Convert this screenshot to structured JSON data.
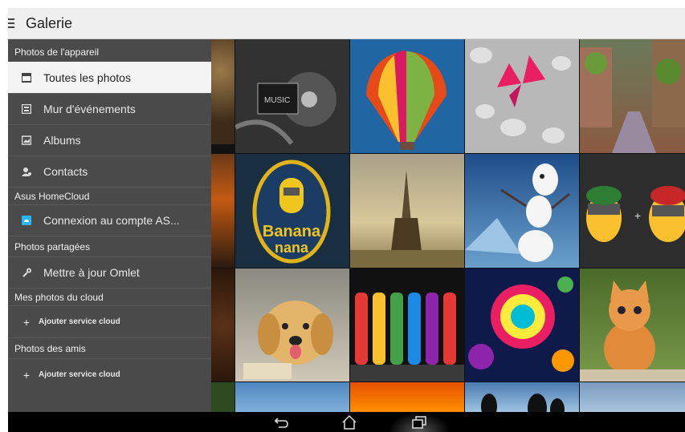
{
  "app": {
    "title": "Galerie"
  },
  "drawer": {
    "device_section": "Photos de l'appareil",
    "device_items": [
      {
        "label": "Toutes les photos",
        "icon": "photos-icon",
        "selected": true
      },
      {
        "label": "Mur d'événements",
        "icon": "event-wall-icon"
      },
      {
        "label": "Albums",
        "icon": "album-icon"
      },
      {
        "label": "Contacts",
        "icon": "contacts-icon"
      }
    ],
    "homecloud_section": "Asus HomeCloud",
    "homecloud_item": {
      "label": "Connexion au compte AS...",
      "icon": "cloud-icon"
    },
    "shared_section": "Photos partagées",
    "shared_item": {
      "label": "Mettre à jour Omlet",
      "icon": "wrench-icon"
    },
    "cloud_section": "Mes photos du cloud",
    "cloud_item": {
      "label": "Ajouter service cloud",
      "icon": "plus-icon"
    },
    "friends_section": "Photos des amis",
    "friends_item": {
      "label": "Ajouter service cloud",
      "icon": "plus-icon"
    }
  },
  "grid": {
    "photos": [
      "music-cd-art",
      "hot-air-balloon",
      "pink-butterfly-pebbles",
      "village-street",
      "tree-lights",
      "banana-minion-logo",
      "eiffel-tower",
      "olaf-snowman",
      "minions-mario",
      "coffee-beans",
      "golden-puppy",
      "colored-bottles",
      "colorful-flowers",
      "orange-kitten",
      "autumn-leaves",
      "blue-sky",
      "red-flowers",
      "penguins",
      "seaside"
    ]
  },
  "navbar": {
    "icons": [
      "back-icon",
      "home-icon",
      "recent-apps-icon"
    ]
  },
  "colors": {
    "drawer_bg": "#4a4a4a",
    "selected_bg": "#f4f4f4",
    "topbar_bg": "#efefef"
  }
}
